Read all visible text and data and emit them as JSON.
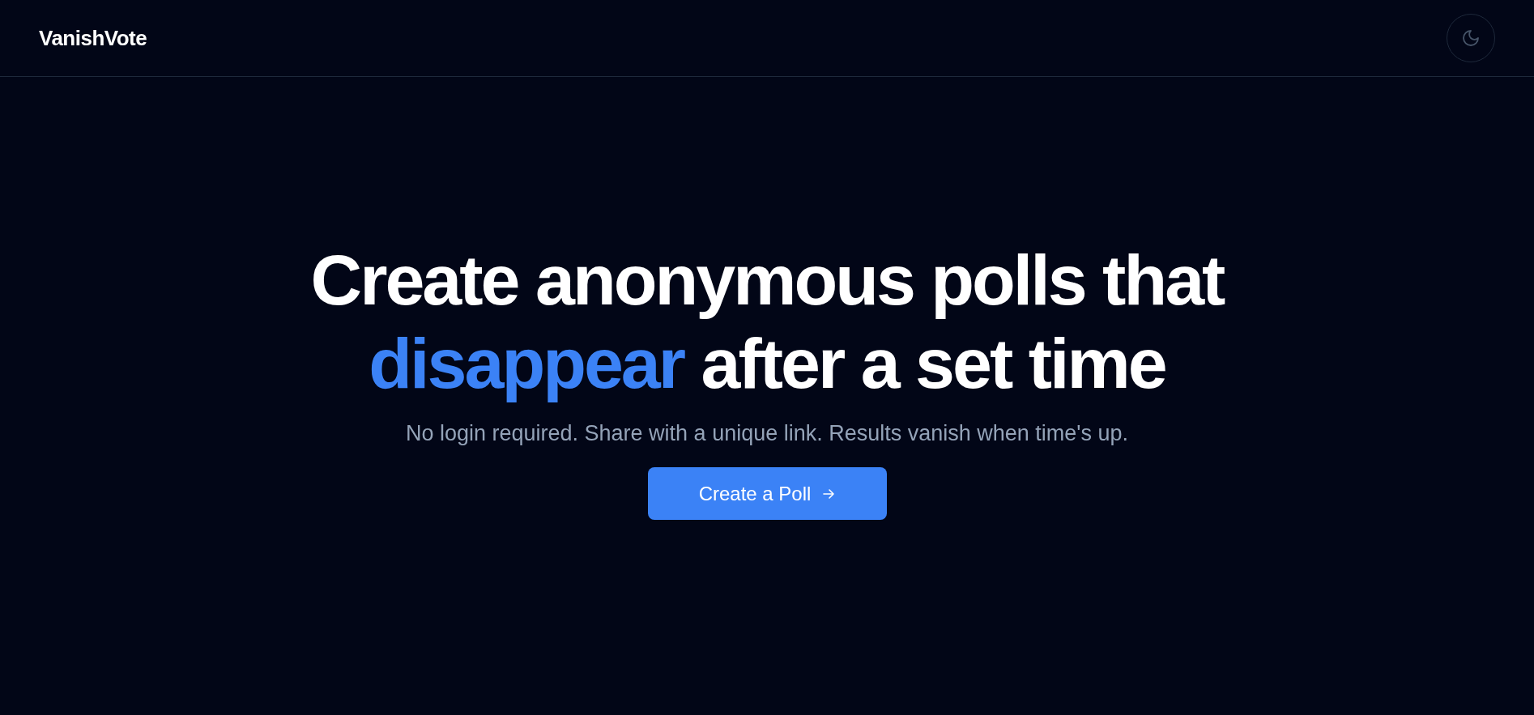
{
  "brand": "VanishVote",
  "theme_toggle": {
    "dark": true
  },
  "headline": [
    {
      "text": "Create anonymous polls that ",
      "highlight": false
    },
    {
      "text": "disappear",
      "highlight": true
    },
    {
      "text": " after a set time",
      "highlight": false
    }
  ],
  "subtitle": "No login required. Share with a unique link. Results vanish when time's up.",
  "cta": {
    "label": "Create a Poll"
  }
}
